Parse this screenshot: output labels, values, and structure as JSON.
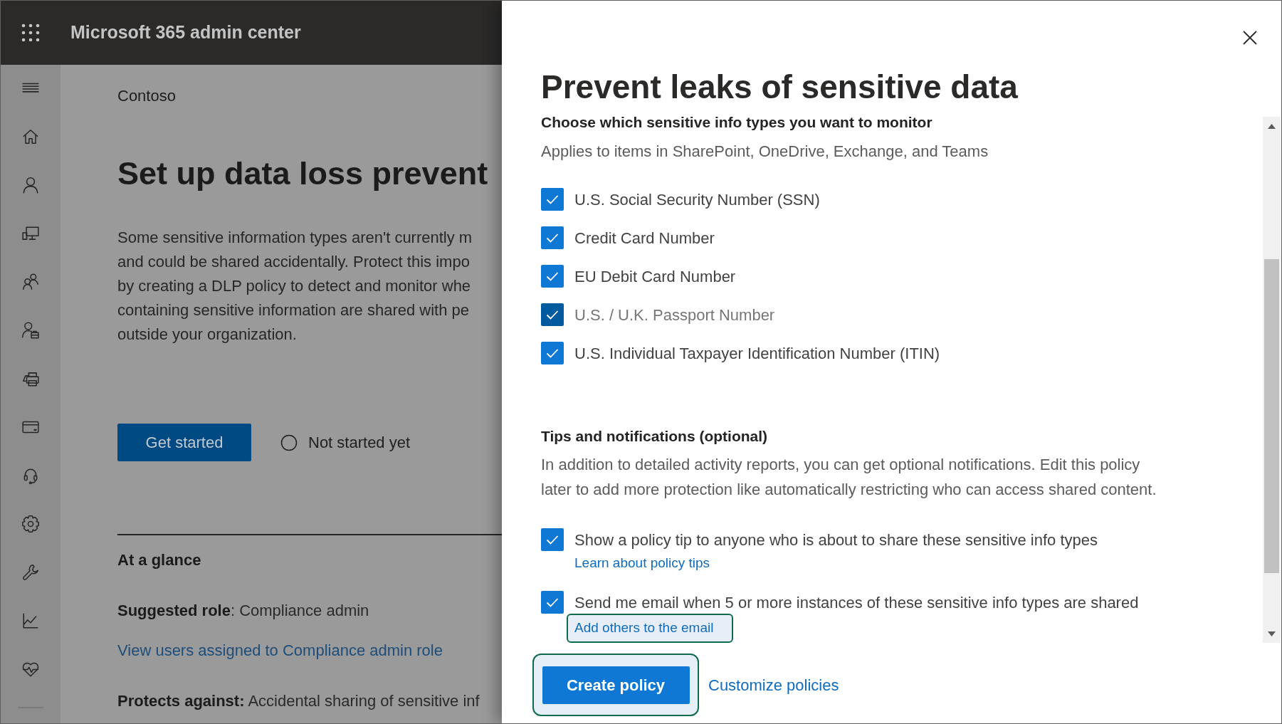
{
  "header": {
    "title": "Microsoft 365 admin center"
  },
  "page": {
    "organization": "Contoso",
    "heading": "Set up data loss prevent",
    "description_lines": [
      "Some sensitive information types aren't currently m",
      "and could be shared accidentally. Protect this impo",
      "by creating a DLP policy to detect and monitor whe",
      "containing sensitive information are shared with pe",
      "outside your organization."
    ],
    "get_started_button": "Get started",
    "status": "Not started yet",
    "at_a_glance": {
      "heading": "At a glance",
      "items": [
        {
          "kind": "text",
          "text": "**Suggested role**: Compliance admin"
        },
        {
          "kind": "link",
          "text": "View users assigned to Compliance admin role"
        },
        {
          "kind": "text",
          "text": "**Protects against:** Accidental sharing of sensitive inf"
        }
      ]
    }
  },
  "panel": {
    "title": "Prevent leaks of sensitive data",
    "info_types": {
      "heading": "Choose which sensitive info types you want to monitor",
      "description": "Applies to items in SharePoint, OneDrive, Exchange, and Teams",
      "options": [
        {
          "label": "U.S. Social Security Number (SSN)",
          "checked": true,
          "hovered": false
        },
        {
          "label": "Credit Card Number",
          "checked": true,
          "hovered": false
        },
        {
          "label": "EU Debit Card Number",
          "checked": true,
          "hovered": false
        },
        {
          "label": "U.S. / U.K. Passport Number",
          "checked": true,
          "hovered": true
        },
        {
          "label": "U.S. Individual Taxpayer Identification Number (ITIN)",
          "checked": true,
          "hovered": false
        }
      ]
    },
    "notifications": {
      "heading": "Tips and notifications (optional)",
      "description": "In addition to detailed activity reports, you can get optional notifications. Edit this policy later to add more protection like automatically restricting who can access shared content.",
      "options": [
        {
          "label": "Show a policy tip to anyone who is about to share these sensitive info types",
          "checked": true,
          "link": {
            "label": "Learn about policy tips",
            "highlighted": false
          }
        },
        {
          "label": "Send me email when 5 or more instances of these sensitive info types are shared",
          "checked": true,
          "link": {
            "label": "Add others to the email",
            "highlighted": true
          }
        }
      ]
    },
    "actions": [
      {
        "kind": "button",
        "label": "Create policy",
        "highlighted": true
      },
      {
        "kind": "link",
        "label": "Customize policies",
        "highlighted": false
      }
    ]
  }
}
